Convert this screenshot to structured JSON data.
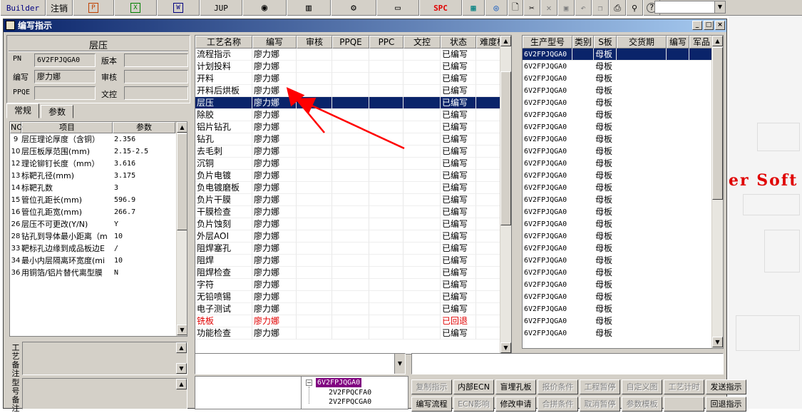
{
  "toolbar": {
    "builder": "Builder",
    "logout": "注销",
    "jup": "JUP",
    "spc": "SPC",
    "excel_glyph": "X",
    "word_glyph": "W"
  },
  "desktop": {
    "bg_text": "er Soft"
  },
  "window": {
    "title": "编写指示"
  },
  "left": {
    "section_title": "层压",
    "pn_label": "PN",
    "pn_value": "6V2FPJQGA0",
    "version_label": "版本",
    "version_value": "",
    "writer_label": "编写",
    "writer_value": "廖力娜",
    "audit_label": "审核",
    "audit_value": "",
    "ppqe_label": "PPQE",
    "ppqe_value": "",
    "textctrl_label": "文控",
    "textctrl_value": "",
    "tabs": [
      "常规",
      "参数"
    ],
    "param_headers": [
      "NO",
      "项目",
      "参数"
    ],
    "params": [
      [
        "9",
        "层压理论厚度（含铜）",
        "2.356"
      ],
      [
        "10",
        "层压板厚范围(mm)",
        "2.15-2.5"
      ],
      [
        "12",
        "理论铆钉长度（mm）",
        "3.616"
      ],
      [
        "13",
        "标靶孔径(mm)",
        "3.175"
      ],
      [
        "14",
        "标靶孔数",
        "3"
      ],
      [
        "15",
        "管位孔距长(mm)",
        "596.9"
      ],
      [
        "16",
        "管位孔距宽(mm)",
        "266.7"
      ],
      [
        "26",
        "层压不可更改(Y/N)",
        "Y"
      ],
      [
        "28",
        "钻孔到导体最小距离（m",
        "10"
      ],
      [
        "33",
        "靶标孔边缘到成品板边E",
        "/"
      ],
      [
        "34",
        "最小内层隔离环宽度(mi",
        "10"
      ],
      [
        "36",
        "用铜箔/铝片替代离型膜",
        "N"
      ]
    ],
    "note_label": "工艺备注",
    "type_label": "型号备注"
  },
  "process": {
    "headers": [
      "工艺名称",
      "编写",
      "审核",
      "PPQE",
      "PPC",
      "文控",
      "状态",
      "难度板"
    ],
    "rows": [
      [
        "流程指示",
        "廖力娜",
        "已编写"
      ],
      [
        "计划投料",
        "廖力娜",
        "已编写"
      ],
      [
        "开料",
        "廖力娜",
        "已编写"
      ],
      [
        "开料后烘板",
        "廖力娜",
        "已编写"
      ],
      [
        "层压",
        "廖力娜",
        "已编写"
      ],
      [
        "除胶",
        "廖力娜",
        "已编写"
      ],
      [
        "铝片钻孔",
        "廖力娜",
        "已编写"
      ],
      [
        "钻孔",
        "廖力娜",
        "已编写"
      ],
      [
        "去毛刺",
        "廖力娜",
        "已编写"
      ],
      [
        "沉铜",
        "廖力娜",
        "已编写"
      ],
      [
        "负片电镀",
        "廖力娜",
        "已编写"
      ],
      [
        "负电镀磨板",
        "廖力娜",
        "已编写"
      ],
      [
        "负片干膜",
        "廖力娜",
        "已编写"
      ],
      [
        "干膜检查",
        "廖力娜",
        "已编写"
      ],
      [
        "负片蚀刻",
        "廖力娜",
        "已编写"
      ],
      [
        "外层AOI",
        "廖力娜",
        "已编写"
      ],
      [
        "阻焊塞孔",
        "廖力娜",
        "已编写"
      ],
      [
        "阻焊",
        "廖力娜",
        "已编写"
      ],
      [
        "阻焊检查",
        "廖力娜",
        "已编写"
      ],
      [
        "字符",
        "廖力娜",
        "已编写"
      ],
      [
        "无铅喷锡",
        "廖力娜",
        "已编写"
      ],
      [
        "电子测试",
        "廖力娜",
        "已编写"
      ],
      [
        "铣板",
        "廖力娜",
        "已回退"
      ],
      [
        "功能检查",
        "廖力娜",
        "已编写"
      ]
    ],
    "selected_index": 4,
    "red_index": 22
  },
  "production": {
    "headers": [
      "生产型号",
      "类别",
      "S板",
      "交货期",
      "编写",
      "军品"
    ],
    "model": "6V2FPJQGA0",
    "sboard": "母板",
    "row_count": 24
  },
  "tree": {
    "root": "6V2FPJQGA0",
    "children": [
      "2V2FPQCFA0",
      "2V2FPQCGA0"
    ]
  },
  "buttons_row1": [
    "复制指示",
    "内部ECN",
    "盲埋孔板",
    "报价条件",
    "工程暂停",
    "自定义图",
    "工艺计时",
    "发送指示"
  ],
  "buttons_row1_enabled": [
    false,
    true,
    true,
    false,
    false,
    false,
    false,
    true
  ],
  "buttons_row2": [
    "编写流程",
    "ECN影响",
    "修改申请",
    "合拼条件",
    "取消暂停",
    "参数模板",
    "",
    "回退指示"
  ],
  "buttons_row2_enabled": [
    true,
    false,
    true,
    false,
    false,
    false,
    false,
    true
  ],
  "colors": {
    "selection": "#0a246a",
    "annotation_arrow": "#ff0000",
    "rollback_text": "#e00000"
  }
}
